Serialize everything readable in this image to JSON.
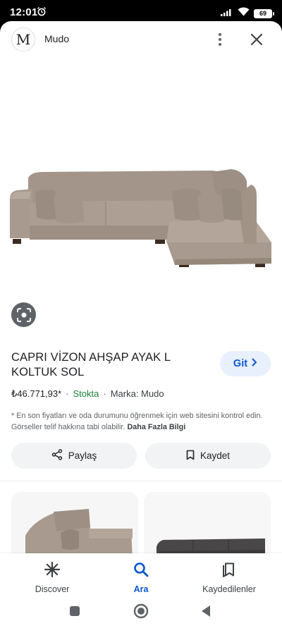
{
  "status_bar": {
    "time": "12:01",
    "battery": "69"
  },
  "header": {
    "brand_logo_letter": "M",
    "brand_name": "Mudo"
  },
  "product": {
    "title": "CAPRI VİZON AHŞAP AYAK L KOLTUK SOL",
    "price": "₺46.771,93*",
    "stock": "Stokta",
    "brand": "Marka: Mudo",
    "disclaimer": "* En son fiyatları ve oda durumunu öğrenmek için web sitesini kontrol edin. Görseller telif hakkına tabi olabilir.",
    "more_info_link": "Daha Fazla Bilgi",
    "go_button": "Git"
  },
  "actions": {
    "share": "Paylaş",
    "save": "Kaydet"
  },
  "bottom_nav": {
    "items": [
      {
        "label": "Discover",
        "icon": "asterisk-icon"
      },
      {
        "label": "Ara",
        "icon": "search-icon",
        "active": true
      },
      {
        "label": "Kaydedilenler",
        "icon": "bookmarks-icon"
      }
    ]
  },
  "colors": {
    "accent": "#0b57d0",
    "accent_bg": "#e8f0fe",
    "stock_green": "#188038",
    "sofa": "#a89a8e",
    "sofa_dark": "#93857a"
  },
  "icons": [
    "alarm-icon",
    "signal-icon",
    "wifi-icon",
    "battery-icon",
    "more-vert-icon",
    "close-icon",
    "lens-icon",
    "chevron-right-icon",
    "share-icon",
    "bookmark-icon",
    "square-icon",
    "circle-icon",
    "triangle-back-icon"
  ]
}
